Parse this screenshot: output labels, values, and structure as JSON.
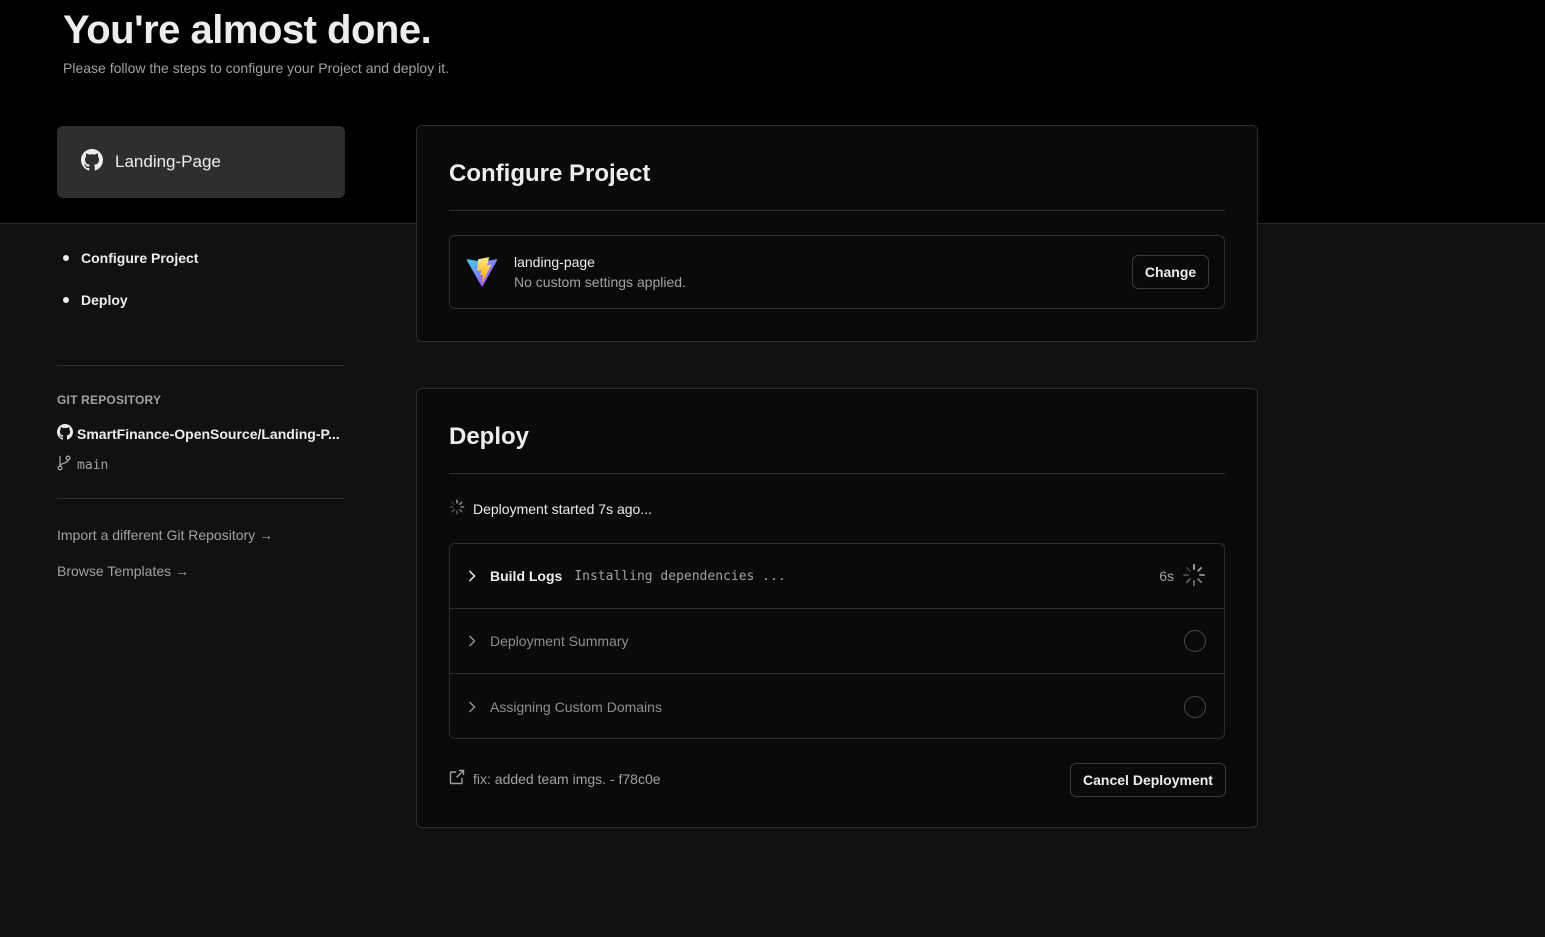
{
  "header": {
    "title": "You're almost done.",
    "subtitle": "Please follow the steps to configure your Project and deploy it."
  },
  "sidebar": {
    "repo_card": {
      "name": "Landing-Page",
      "icon": "github-icon"
    },
    "steps": [
      {
        "label": "Configure Project"
      },
      {
        "label": "Deploy"
      }
    ],
    "git": {
      "section_label": "GIT REPOSITORY",
      "repo": "SmartFinance-OpenSource/Landing-P...",
      "branch": "main"
    },
    "links": {
      "import": "Import a different Git Repository →",
      "templates": "Browse Templates →"
    }
  },
  "configure": {
    "title": "Configure Project",
    "framework": {
      "name": "landing-page",
      "description": "No custom settings applied.",
      "icon": "vite-icon"
    },
    "change_label": "Change"
  },
  "deploy": {
    "title": "Deploy",
    "status": "Deployment started 7s ago...",
    "steps": [
      {
        "label": "Build Logs",
        "detail": "Installing dependencies ...",
        "time": "6s",
        "state": "running"
      },
      {
        "label": "Deployment Summary",
        "state": "pending"
      },
      {
        "label": "Assigning Custom Domains",
        "state": "pending"
      }
    ],
    "commit": "fix: added team imgs. - f78c0e",
    "cancel_label": "Cancel Deployment"
  },
  "colors": {
    "background": "#111111",
    "header_band": "#000000",
    "card": "#0a0a0a",
    "border": "#2e2e2e",
    "text": "#ededed",
    "muted": "#a1a1a1"
  }
}
